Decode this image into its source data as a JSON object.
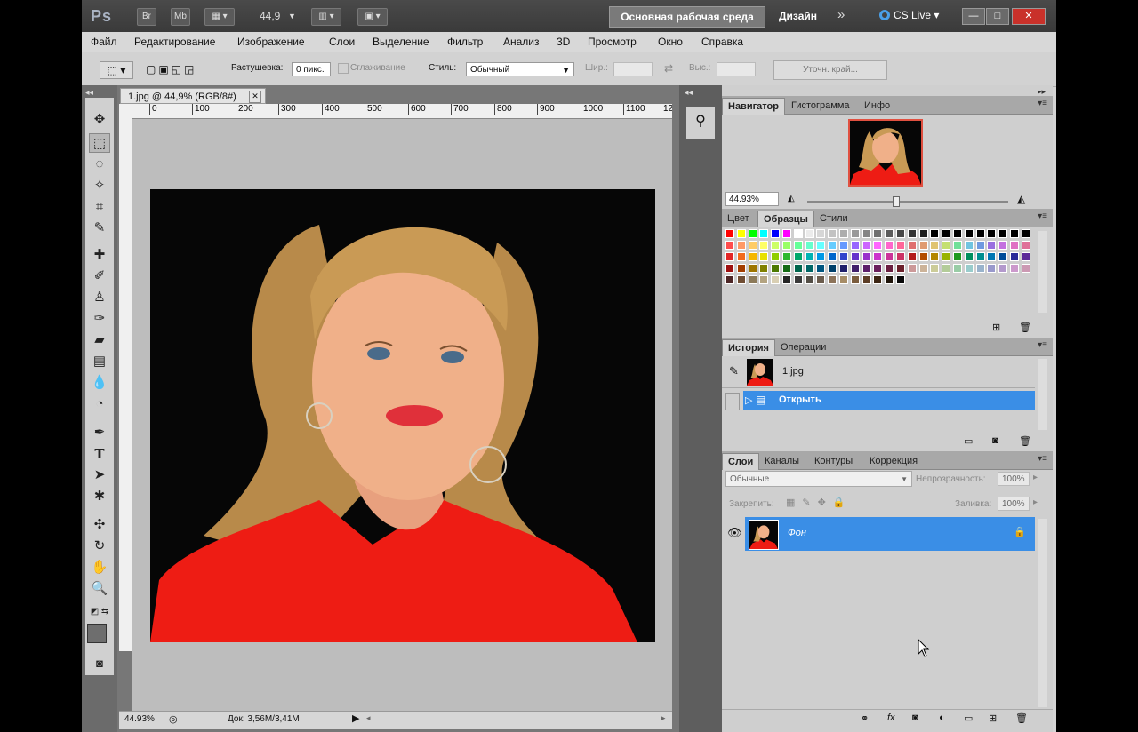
{
  "titlebar": {
    "logo": "Ps",
    "br": "Br",
    "mb": "Mb",
    "zoom": "44,9",
    "workspace": "Основная рабочая среда",
    "design": "Дизайн",
    "more": "»",
    "cs_live": "CS Live",
    "win_min": "—",
    "win_max": "□",
    "win_close": "✕"
  },
  "menu": [
    "Файл",
    "Редактирование",
    "Изображение",
    "Слои",
    "Выделение",
    "Фильтр",
    "Анализ",
    "3D",
    "Просмотр",
    "Окно",
    "Справка"
  ],
  "options": {
    "feather_label": "Растушевка:",
    "feather_value": "0 пикс.",
    "antialias_label": "Сглаживание",
    "style_label": "Стиль:",
    "style_value": "Обычный",
    "width_label": "Шир.:",
    "height_label": "Выс.:",
    "refine_label": "Уточн. край..."
  },
  "document": {
    "tab_title": "1.jpg @ 44,9% (RGB/8#)",
    "ruler": [
      "0",
      "100",
      "200",
      "300",
      "400",
      "500",
      "600",
      "700",
      "800",
      "900",
      "1000",
      "1100",
      "12"
    ],
    "status_zoom": "44.93%",
    "status_doc": "Док: 3,56M/3,41M"
  },
  "navigator": {
    "tabs": [
      "Навигатор",
      "Гистограмма",
      "Инфо"
    ],
    "zoom": "44.93%"
  },
  "swatches_panel": {
    "tabs": [
      "Цвет",
      "Образцы",
      "Стили"
    ],
    "rows": [
      [
        "#ff0000",
        "#ffff00",
        "#00ff00",
        "#00ffff",
        "#0000ff",
        "#ff00ff",
        "#ffffff",
        "#ebebeb",
        "#d6d6d6",
        "#c2c2c2",
        "#adadad",
        "#999999",
        "#858585",
        "#707070",
        "#5c5c5c",
        "#474747",
        "#333333",
        "#1f1f1f",
        "#000000",
        "#000000",
        "#000000",
        "#000000",
        "#000000",
        "#000000",
        "#000000",
        "#000000",
        "#000000"
      ],
      [
        "#ff4d4d",
        "#ff9966",
        "#ffcc66",
        "#ffff66",
        "#ccff66",
        "#99ff66",
        "#66ff99",
        "#66ffcc",
        "#66ffff",
        "#66ccff",
        "#6699ff",
        "#9966ff",
        "#cc66ff",
        "#ff66ff",
        "#ff66cc",
        "#ff6699",
        "#e07070",
        "#e09a70",
        "#e0c470",
        "#c4e070",
        "#70e09a",
        "#70c4e0",
        "#709ae0",
        "#9a70e0",
        "#c470e0",
        "#e070c4",
        "#e07099"
      ],
      [
        "#e32626",
        "#f26b1d",
        "#f5b700",
        "#e8e000",
        "#8fce00",
        "#2eb82e",
        "#00a86b",
        "#00b3b3",
        "#0099e6",
        "#0066cc",
        "#3344cc",
        "#6633cc",
        "#9933cc",
        "#cc33cc",
        "#cc3399",
        "#cc3366",
        "#b31b1b",
        "#b34d00",
        "#b38600",
        "#99b300",
        "#1f991f",
        "#008f5d",
        "#008f8f",
        "#0077b3",
        "#004c99",
        "#2a2a99",
        "#5c2a99"
      ],
      [
        "#9e1010",
        "#a33d00",
        "#9e7500",
        "#808000",
        "#4d7a00",
        "#146b14",
        "#00664d",
        "#006666",
        "#005580",
        "#00406b",
        "#1f1f6b",
        "#401f6b",
        "#5c1f6b",
        "#6b1f5c",
        "#6b1f40",
        "#6b1f2a",
        "#cc9999",
        "#ccb399",
        "#cccc99",
        "#b3cc99",
        "#99cca6",
        "#99cccc",
        "#99b3cc",
        "#9999cc",
        "#b399cc",
        "#cc99cc",
        "#cc99b3"
      ],
      [
        "#4d2626",
        "#704d33",
        "#8c7a59",
        "#b3a380",
        "#d9cfb3",
        "#262626",
        "#3a3a3a",
        "#524d45",
        "#6b5c4d",
        "#8c7359",
        "#a68c66",
        "#7a5c3d",
        "#5c3d26",
        "#3d2614",
        "#1f140a",
        "#0a0a0a"
      ]
    ]
  },
  "history": {
    "tabs": [
      "История",
      "Операции"
    ],
    "snapshot": "1.jpg",
    "step": "Открыть"
  },
  "layers": {
    "tabs": [
      "Слои",
      "Каналы",
      "Контуры",
      "Коррекция"
    ],
    "blend": "Обычные",
    "opacity_label": "Непрозрачность:",
    "opacity": "100%",
    "lock_label": "Закрепить:",
    "fill_label": "Заливка:",
    "fill": "100%",
    "layer_name": "Фон"
  },
  "colors": {
    "accent": "#3a8ee6",
    "shirt": "#ee1c14",
    "hair": "#c99a55",
    "skin": "#f0b089"
  }
}
